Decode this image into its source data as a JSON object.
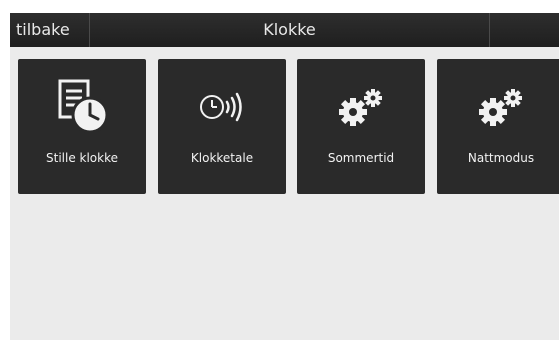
{
  "header": {
    "back_label": "tilbake",
    "title": "Klokke"
  },
  "tiles": [
    {
      "label": "Stille klokke",
      "icon": "set-clock-icon"
    },
    {
      "label": "Klokketale",
      "icon": "clock-speech-icon"
    },
    {
      "label": "Sommertid",
      "icon": "gears-icon"
    },
    {
      "label": "Nattmodus",
      "icon": "gears-icon"
    }
  ],
  "colors": {
    "header_bg": "#222222",
    "tile_bg": "#2a2a2a",
    "screen_bg": "#ebebeb",
    "text": "#f2f2f2"
  }
}
